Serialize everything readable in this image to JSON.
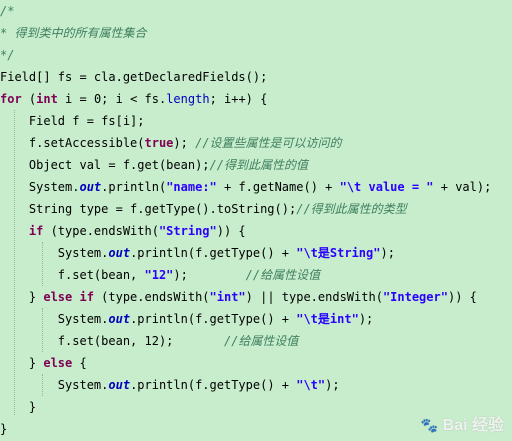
{
  "code": {
    "lines": [
      [
        {
          "t": "/*",
          "c": "cm"
        }
      ],
      [
        {
          "t": "* 得到类中的所有属性集合",
          "c": "cm"
        }
      ],
      [
        {
          "t": "*/",
          "c": "cm"
        }
      ],
      [
        {
          "t": "Field[] fs = cla.getDeclaredFields();",
          "c": ""
        }
      ],
      [
        {
          "t": "for",
          "c": "kw"
        },
        {
          "t": " (",
          "c": ""
        },
        {
          "t": "int",
          "c": "kw"
        },
        {
          "t": " i = 0; i < fs.",
          "c": ""
        },
        {
          "t": "length",
          "c": "fld2"
        },
        {
          "t": "; i++) {",
          "c": ""
        }
      ],
      [
        {
          "t": "    Field f = fs[i];",
          "c": ""
        }
      ],
      [
        {
          "t": "    f.setAccessible(",
          "c": ""
        },
        {
          "t": "true",
          "c": "kw"
        },
        {
          "t": "); ",
          "c": ""
        },
        {
          "t": "//设置些属性是可以访问的",
          "c": "cm"
        }
      ],
      [
        {
          "t": "    Object val = f.get(bean);",
          "c": ""
        },
        {
          "t": "//得到此属性的值",
          "c": "cm"
        }
      ],
      [
        {
          "t": "    System.",
          "c": ""
        },
        {
          "t": "out",
          "c": "fld"
        },
        {
          "t": ".println(",
          "c": ""
        },
        {
          "t": "\"name:\"",
          "c": "str"
        },
        {
          "t": " + f.getName() + ",
          "c": ""
        },
        {
          "t": "\"\\t value = \"",
          "c": "str"
        },
        {
          "t": " + val);",
          "c": ""
        }
      ],
      [
        {
          "t": "    String type = f.getType().toString();",
          "c": ""
        },
        {
          "t": "//得到此属性的类型",
          "c": "cm"
        }
      ],
      [
        {
          "t": "    ",
          "c": ""
        },
        {
          "t": "if",
          "c": "kw"
        },
        {
          "t": " (type.endsWith(",
          "c": ""
        },
        {
          "t": "\"String\"",
          "c": "str"
        },
        {
          "t": ")) {",
          "c": ""
        }
      ],
      [
        {
          "t": "        System.",
          "c": ""
        },
        {
          "t": "out",
          "c": "fld"
        },
        {
          "t": ".println(f.getType() + ",
          "c": ""
        },
        {
          "t": "\"\\t是String\"",
          "c": "str"
        },
        {
          "t": ");",
          "c": ""
        }
      ],
      [
        {
          "t": "        f.set(bean, ",
          "c": ""
        },
        {
          "t": "\"12\"",
          "c": "str"
        },
        {
          "t": ");        ",
          "c": ""
        },
        {
          "t": "//给属性设值",
          "c": "cm"
        }
      ],
      [
        {
          "t": "    } ",
          "c": ""
        },
        {
          "t": "else if",
          "c": "kw"
        },
        {
          "t": " (type.endsWith(",
          "c": ""
        },
        {
          "t": "\"int\"",
          "c": "str"
        },
        {
          "t": ") || type.endsWith(",
          "c": ""
        },
        {
          "t": "\"Integer\"",
          "c": "str"
        },
        {
          "t": ")) {",
          "c": ""
        }
      ],
      [
        {
          "t": "        System.",
          "c": ""
        },
        {
          "t": "out",
          "c": "fld"
        },
        {
          "t": ".println(f.getType() + ",
          "c": ""
        },
        {
          "t": "\"\\t是int\"",
          "c": "str"
        },
        {
          "t": ");",
          "c": ""
        }
      ],
      [
        {
          "t": "        f.set(bean, 12);       ",
          "c": ""
        },
        {
          "t": "//给属性设值",
          "c": "cm"
        }
      ],
      [
        {
          "t": "    } ",
          "c": ""
        },
        {
          "t": "else",
          "c": "kw"
        },
        {
          "t": " {",
          "c": ""
        }
      ],
      [
        {
          "t": "        System.",
          "c": ""
        },
        {
          "t": "out",
          "c": "fld"
        },
        {
          "t": ".println(f.getType() + ",
          "c": ""
        },
        {
          "t": "\"\\t\"",
          "c": "str"
        },
        {
          "t": ");",
          "c": ""
        }
      ],
      [
        {
          "t": "    }",
          "c": ""
        }
      ],
      [
        {
          "t": "}",
          "c": ""
        }
      ]
    ]
  },
  "watermark": {
    "text": "Bai 经验",
    "icon": "baidu-paw-icon"
  },
  "colors": {
    "background": "#c7edcc",
    "comment": "#3f7f5f",
    "keyword": "#7f0055",
    "string": "#2a00ff",
    "field": "#0000c0"
  }
}
